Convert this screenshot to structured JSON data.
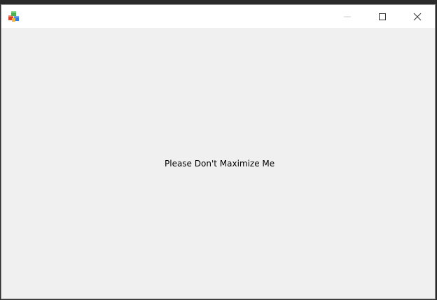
{
  "window": {
    "title": "",
    "message": "Please Don't Maximize Me"
  },
  "icons": {
    "app": "app-cubes-icon",
    "minimize": "minimize-icon",
    "maximize": "maximize-icon",
    "close": "close-icon"
  },
  "colors": {
    "titlebar": "#ffffff",
    "client": "#f0f0f0",
    "desktop": "#2b2b2b",
    "caption_glyph": "#333333",
    "caption_glyph_disabled": "#cccccc"
  }
}
